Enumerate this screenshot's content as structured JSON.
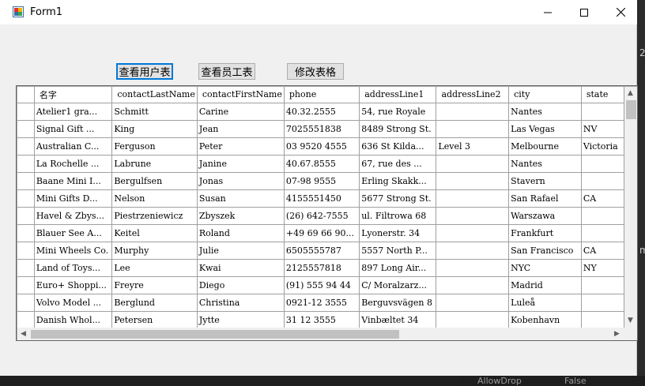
{
  "window": {
    "title": "Form1"
  },
  "toolbar": {
    "view_users_label": "查看用户表",
    "view_employees_label": "查看员工表",
    "edit_table_label": "修改表格"
  },
  "grid": {
    "columns": [
      "名字",
      "contactLastName",
      "contactFirstName",
      "phone",
      "addressLine1",
      "addressLine2",
      "city",
      "state"
    ],
    "rows": [
      [
        "Atelier1 gra...",
        "Schmitt",
        "Carine",
        "40.32.2555",
        "54, rue Royale",
        "",
        "Nantes",
        ""
      ],
      [
        "Signal Gift ...",
        "King",
        "Jean",
        "7025551838",
        "8489 Strong St.",
        "",
        "Las Vegas",
        "NV"
      ],
      [
        "Australian C...",
        "Ferguson",
        "Peter",
        "03 9520 4555",
        "636 St Kilda...",
        "Level 3",
        "Melbourne",
        "Victoria"
      ],
      [
        "La Rochelle ...",
        "Labrune",
        "Janine",
        "40.67.8555",
        "67, rue des ...",
        "",
        "Nantes",
        ""
      ],
      [
        "Baane Mini I...",
        "Bergulfsen",
        "Jonas",
        "07-98 9555",
        "Erling Skakk...",
        "",
        "Stavern",
        ""
      ],
      [
        "Mini Gifts D...",
        "Nelson",
        "Susan",
        "4155551450",
        "5677 Strong St.",
        "",
        "San Rafael",
        "CA"
      ],
      [
        "Havel & Zbys...",
        "Piestrzeniewicz",
        "Zbyszek",
        "(26) 642-7555",
        "ul. Filtrowa 68",
        "",
        "Warszawa",
        ""
      ],
      [
        "Blauer See A...",
        "Keitel",
        "Roland",
        "+49 69 66 90...",
        "Lyonerstr. 34",
        "",
        "Frankfurt",
        ""
      ],
      [
        "Mini Wheels Co.",
        "Murphy",
        "Julie",
        "6505555787",
        "5557 North P...",
        "",
        "San Francisco",
        "CA"
      ],
      [
        "Land of Toys...",
        "Lee",
        "Kwai",
        "2125557818",
        "897 Long Air...",
        "",
        "NYC",
        "NY"
      ],
      [
        "Euro+ Shoppi...",
        "Freyre",
        "Diego",
        "(91) 555 94 44",
        "C/ Moralzarz...",
        "",
        "Madrid",
        ""
      ],
      [
        "Volvo Model ...",
        "Berglund",
        "Christina",
        "0921-12 3555",
        "Berguvsvägen  8",
        "",
        "Luleå",
        ""
      ],
      [
        "Danish Whol...",
        "Petersen",
        "Jytte",
        "31 12 3555",
        "Vinbæltet 34",
        "",
        "Kobenhavn",
        ""
      ]
    ]
  },
  "background": {
    "digit": "2",
    "fragment": "m",
    "prop_name": "AllowDrop",
    "prop_value": "False"
  }
}
